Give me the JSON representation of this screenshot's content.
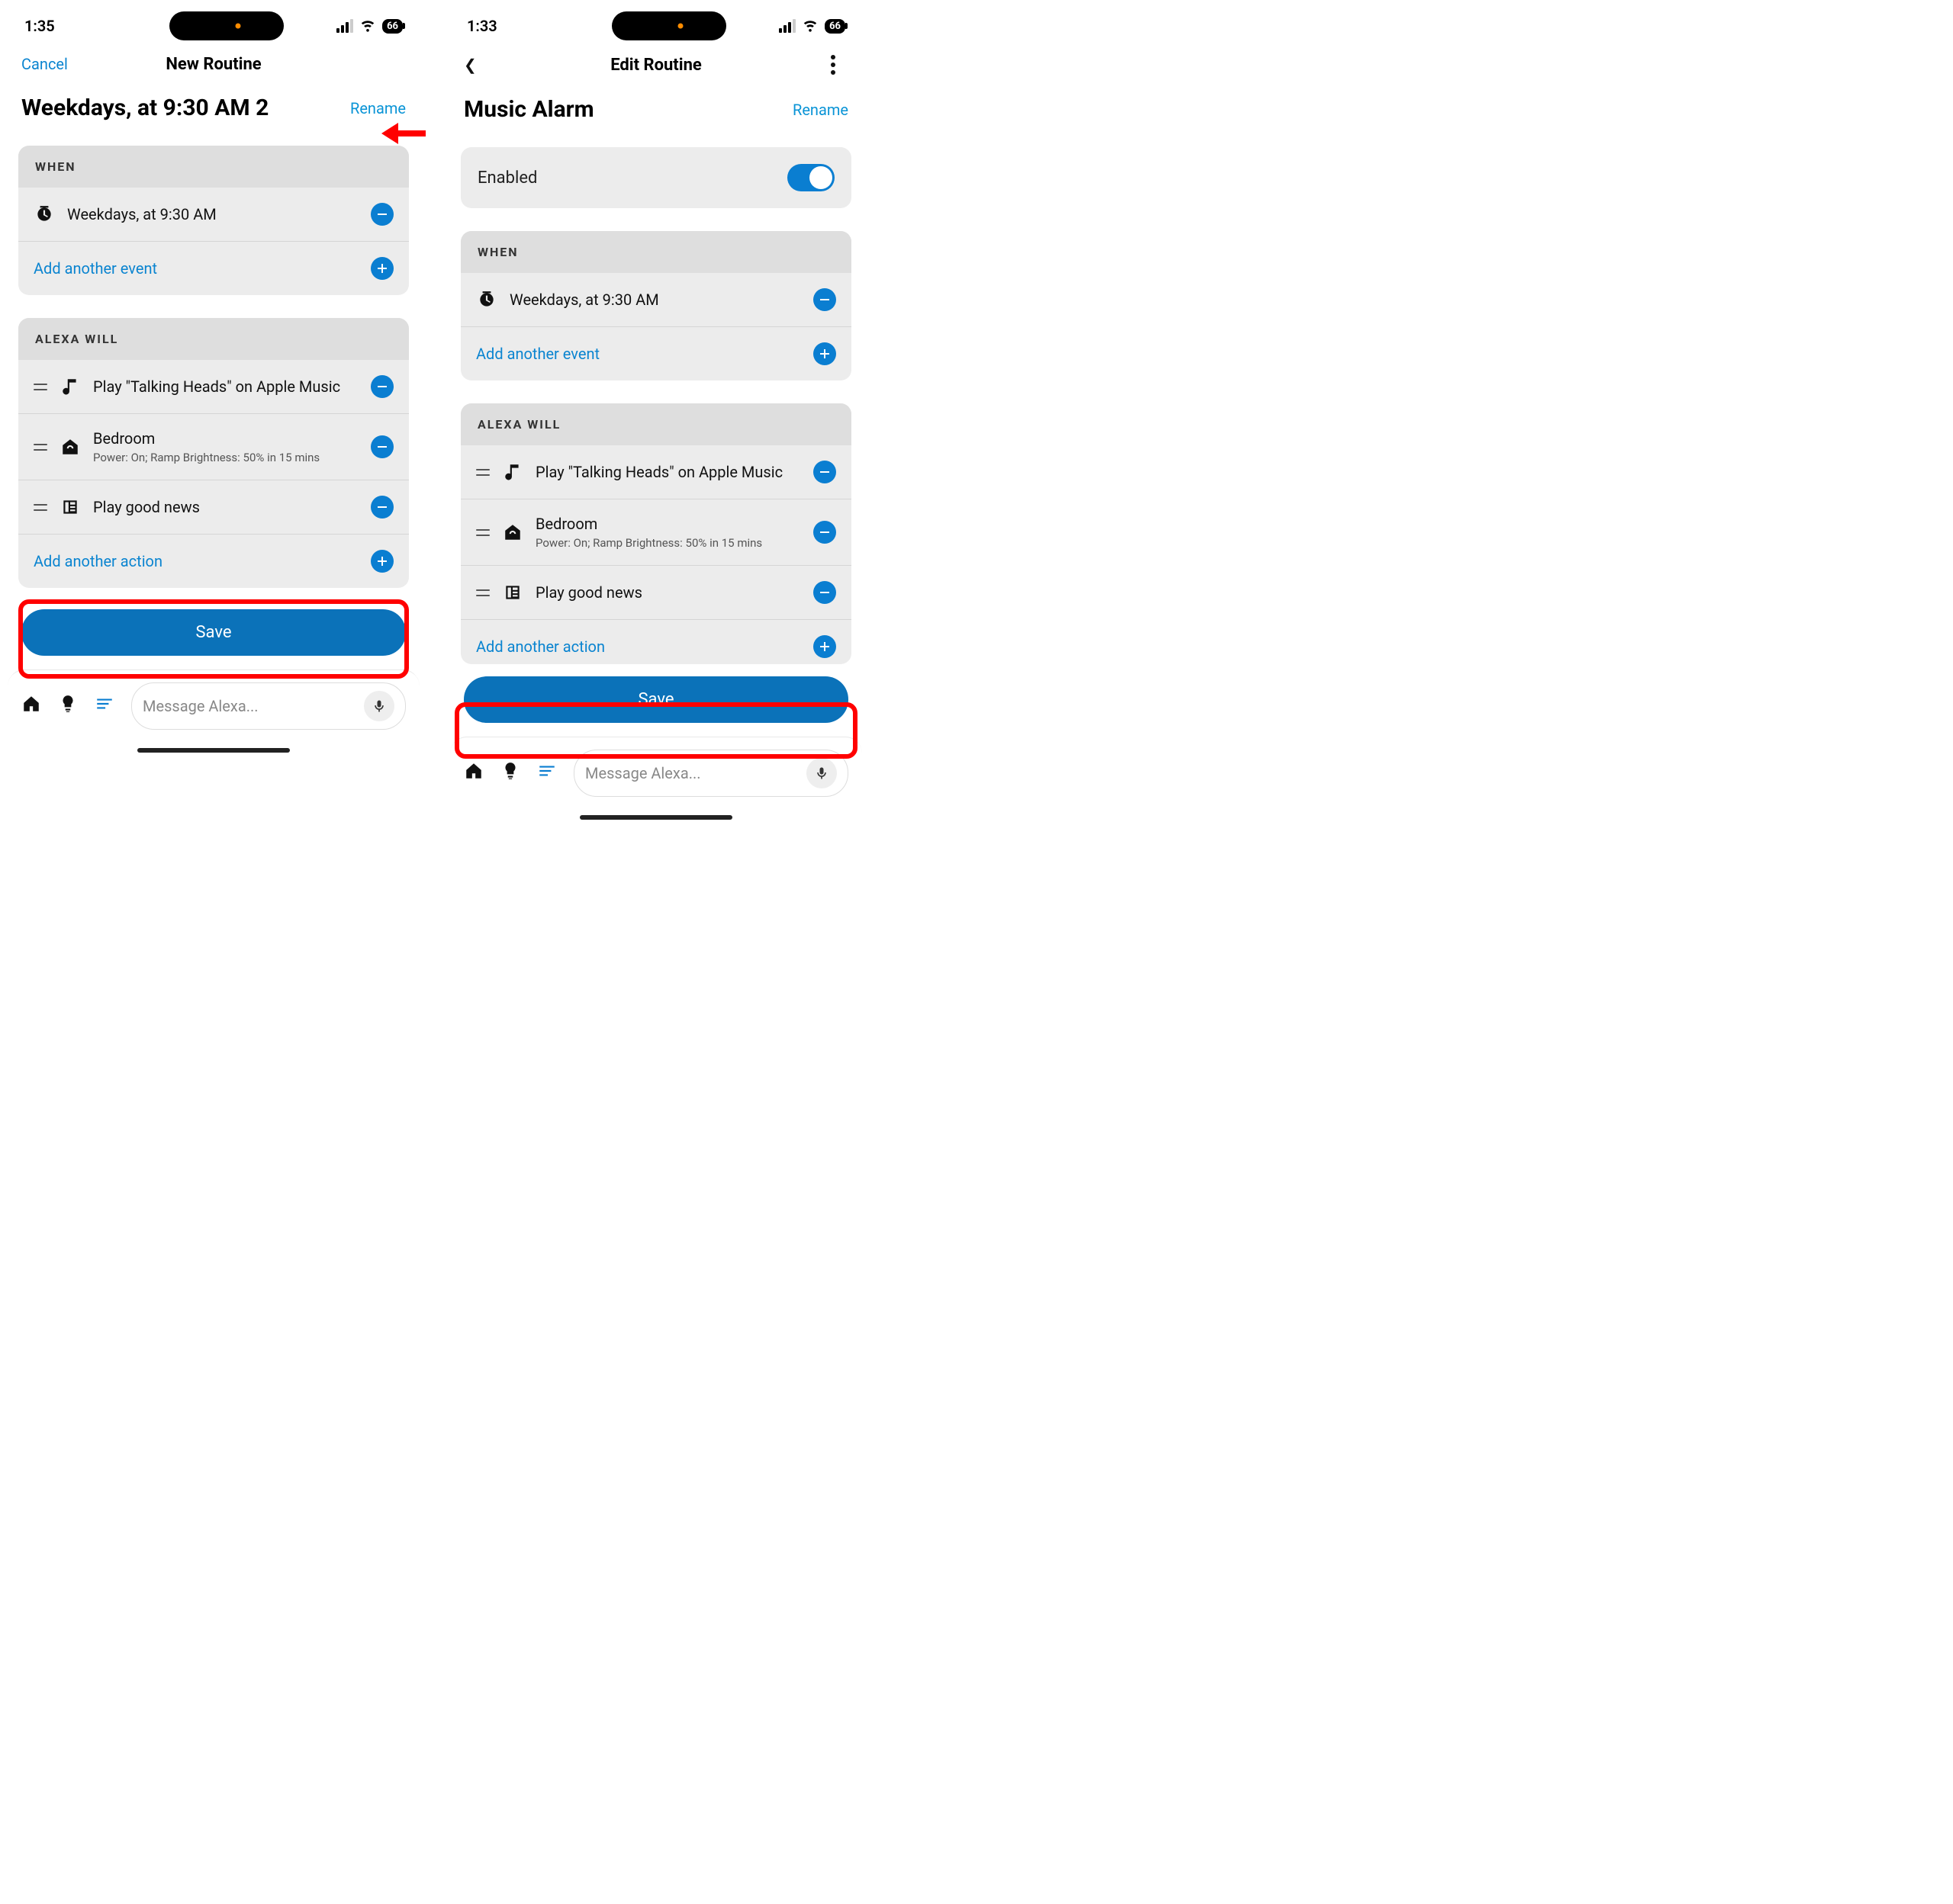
{
  "left": {
    "status_time": "1:35",
    "battery": "66",
    "cancel": "Cancel",
    "nav_title": "New Routine",
    "title": "Weekdays, at 9:30 AM 2",
    "rename": "Rename",
    "when_header": "WHEN",
    "when_event": "Weekdays, at 9:30 AM",
    "add_event": "Add another event",
    "alexa_header": "ALEXA WILL",
    "actions": [
      {
        "primary": "Play \"Talking Heads\" on Apple Music",
        "secondary": ""
      },
      {
        "primary": "Bedroom",
        "secondary": "Power: On; Ramp Brightness: 50% in 15 mins"
      },
      {
        "primary": "Play good news",
        "secondary": ""
      }
    ],
    "add_action": "Add another action",
    "save": "Save",
    "alexa_placeholder": "Message Alexa..."
  },
  "right": {
    "status_time": "1:33",
    "battery": "66",
    "nav_title": "Edit Routine",
    "title": "Music Alarm",
    "rename": "Rename",
    "enabled_label": "Enabled",
    "when_header": "WHEN",
    "when_event": "Weekdays, at 9:30 AM",
    "add_event": "Add another event",
    "alexa_header": "ALEXA WILL",
    "actions": [
      {
        "primary": "Play \"Talking Heads\" on Apple Music",
        "secondary": ""
      },
      {
        "primary": "Bedroom",
        "secondary": "Power: On; Ramp Brightness: 50% in 15 mins"
      },
      {
        "primary": "Play good news",
        "secondary": ""
      }
    ],
    "add_action": "Add another action",
    "save": "Save",
    "alexa_placeholder": "Message Alexa..."
  }
}
